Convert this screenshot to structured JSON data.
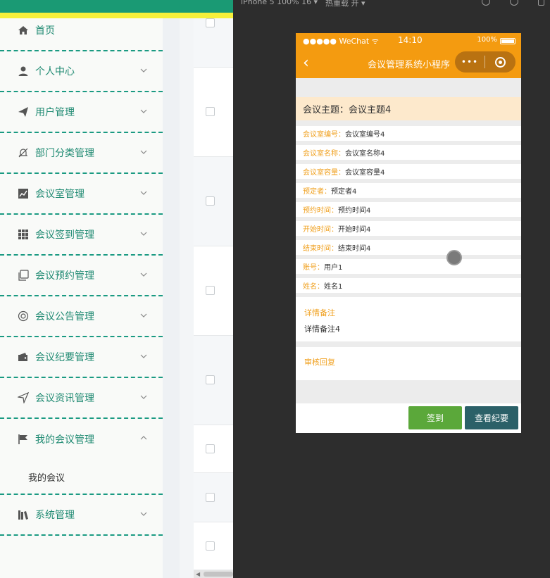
{
  "admin": {
    "menu": [
      {
        "label": "首页",
        "icon": "home-icon",
        "chevron": ""
      },
      {
        "label": "个人中心",
        "icon": "user-icon",
        "chevron": "down"
      },
      {
        "label": "用户管理",
        "icon": "send-icon",
        "chevron": "down"
      },
      {
        "label": "部门分类管理",
        "icon": "bell-off-icon",
        "chevron": "down"
      },
      {
        "label": "会议室管理",
        "icon": "chart-icon",
        "chevron": "down"
      },
      {
        "label": "会议签到管理",
        "icon": "grid-icon",
        "chevron": "down"
      },
      {
        "label": "会议预约管理",
        "icon": "copy-icon",
        "chevron": "down"
      },
      {
        "label": "会议公告管理",
        "icon": "lifebuoy-icon",
        "chevron": "down"
      },
      {
        "label": "会议纪要管理",
        "icon": "wallet-icon",
        "chevron": "down"
      },
      {
        "label": "会议资讯管理",
        "icon": "navigation-icon",
        "chevron": "down"
      },
      {
        "label": "我的会议管理",
        "icon": "flag-icon",
        "chevron": "up"
      },
      {
        "label": "系统管理",
        "icon": "books-icon",
        "chevron": "down"
      }
    ],
    "submenu": {
      "label": "我的会议"
    }
  },
  "simulator": {
    "device": "iPhone 5 100% 16 ▾",
    "reload": "热重载 开 ▾"
  },
  "phone": {
    "status": {
      "carrier": "●●●●● WeChat ᯤ",
      "time": "14:10",
      "battery": "100%"
    },
    "navbar": {
      "back": "‹",
      "title": "会议管理系统小程序",
      "menu": "•••"
    },
    "topic": "会议主题：会议主题4",
    "fields": [
      {
        "key": "会议室编号：",
        "value": "会议室编号4"
      },
      {
        "key": "会议室名称：",
        "value": "会议室名称4"
      },
      {
        "key": "会议室容量：",
        "value": "会议室容量4"
      },
      {
        "key": "预定者：",
        "value": "预定者4"
      },
      {
        "key": "预约时间：",
        "value": "预约时间4"
      },
      {
        "key": "开始时间：",
        "value": "开始时间4"
      },
      {
        "key": "结束时间：",
        "value": "结束时间4"
      },
      {
        "key": "账号：",
        "value": "用户1"
      },
      {
        "key": "姓名：",
        "value": "姓名1"
      }
    ],
    "detail": {
      "key": "详情备注",
      "value": "详情备注4"
    },
    "review": {
      "key": "审核回复"
    },
    "buttons": {
      "sign": "签到",
      "view": "查看纪要"
    }
  },
  "colors": {
    "accent": "#f49b10",
    "menu_text": "#1f8a72",
    "sign": "#5ba83a",
    "view": "#2b6068"
  }
}
